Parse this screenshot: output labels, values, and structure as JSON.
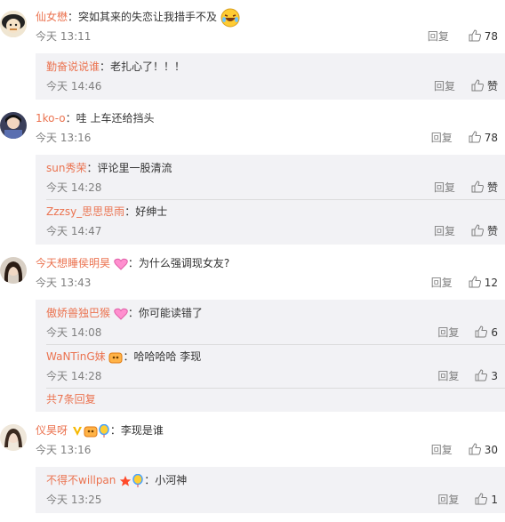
{
  "comments": [
    {
      "user": "仙女懋",
      "text": "突如其来的失恋让我措手不及",
      "time": "今天 13:11",
      "reply_label": "回复",
      "likes": "78",
      "replies": [
        {
          "user": "勤奋说说谁",
          "text": "老扎心了！！！",
          "time": "今天 14:46",
          "reply_label": "回复",
          "likes": "赞"
        }
      ]
    },
    {
      "user": "1ko-o",
      "text": "哇 上车还给挡头",
      "time": "今天 13:16",
      "reply_label": "回复",
      "likes": "78",
      "replies": [
        {
          "user": "sun秀荣",
          "text": "评论里一股清流",
          "time": "今天 14:28",
          "reply_label": "回复",
          "likes": "赞"
        },
        {
          "user": "Zzzsy_思思思雨",
          "text": "好绅士",
          "time": "今天 14:47",
          "reply_label": "回复",
          "likes": "赞"
        }
      ]
    },
    {
      "user": "今天想睡侯明昊",
      "text": "为什么强调现女友?",
      "time": "今天 13:43",
      "reply_label": "回复",
      "likes": "12",
      "replies": [
        {
          "user": "傲娇兽独巴猴",
          "text": "你可能读错了",
          "time": "今天 14:08",
          "reply_label": "回复",
          "likes": "6"
        },
        {
          "user": "WaNTinG妹",
          "text": "哈哈哈哈  李现",
          "time": "今天 14:28",
          "reply_label": "回复",
          "likes": "3"
        }
      ],
      "more_label": "共7条回复"
    },
    {
      "user": "仪昊呀",
      "text": "李现是谁",
      "time": "今天 13:16",
      "reply_label": "回复",
      "likes": "30",
      "replies": [
        {
          "user": "不得不willpan",
          "text": "小河神",
          "time": "今天 13:25",
          "reply_label": "回复",
          "likes": "1"
        }
      ]
    }
  ],
  "colors": {
    "username": "#eb7350",
    "reply_bg": "#f2f2f5",
    "meta": "#808080"
  },
  "icons": [
    "laughing-emoji-icon",
    "thumb-up-icon",
    "pink-heart-icon",
    "badge-icon",
    "star-icon",
    "balloon-icon"
  ]
}
